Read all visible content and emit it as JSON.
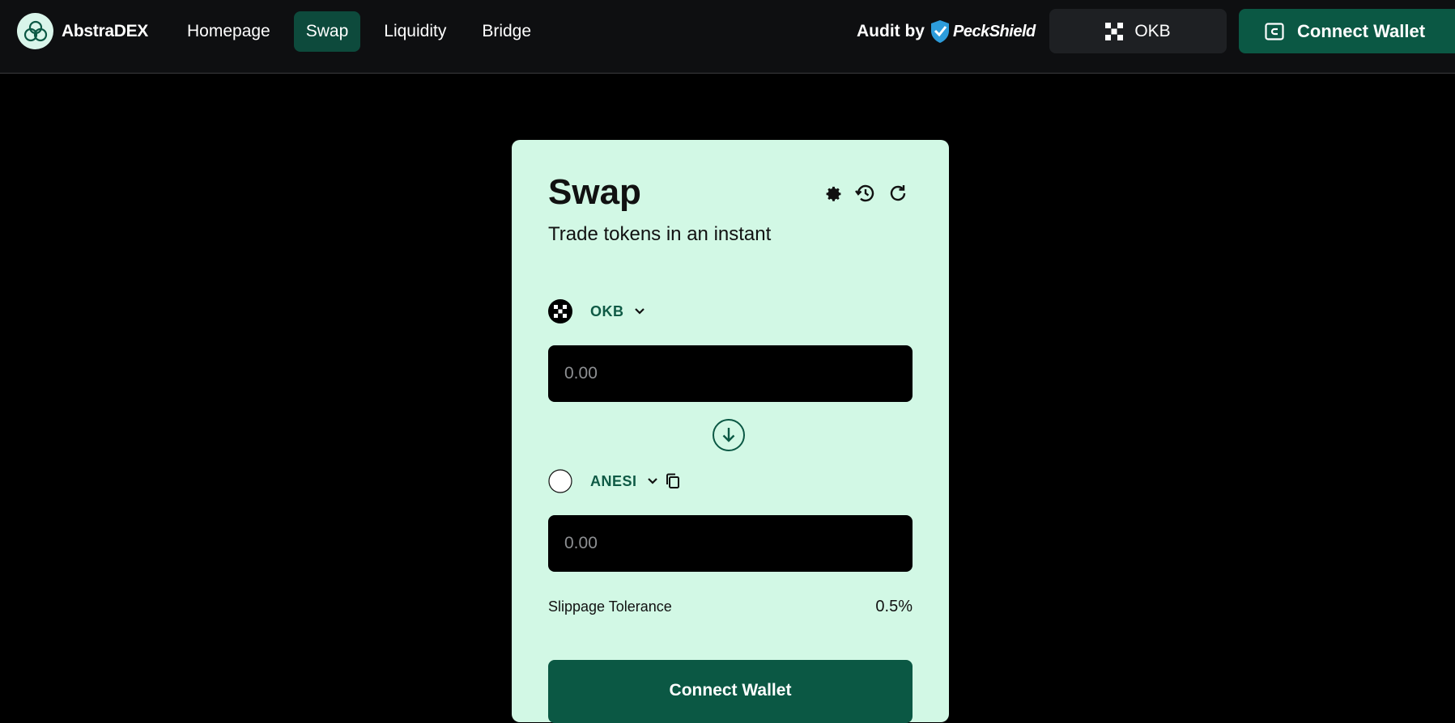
{
  "header": {
    "brand": "AbstraDEX",
    "nav": [
      {
        "label": "Homepage",
        "active": false
      },
      {
        "label": "Swap",
        "active": true
      },
      {
        "label": "Liquidity",
        "active": false
      },
      {
        "label": "Bridge",
        "active": false
      }
    ],
    "audit_label": "Audit by",
    "auditor": "PeckShield",
    "network_label": "OKB",
    "connect_label": "Connect Wallet"
  },
  "swap": {
    "title": "Swap",
    "subtitle": "Trade tokens in an instant",
    "icons": [
      "settings-icon",
      "history-icon",
      "refresh-icon"
    ],
    "from_token": "OKB",
    "from_placeholder": "0.00",
    "to_token": "ANESI",
    "to_placeholder": "0.00",
    "slippage_label": "Slippage Tolerance",
    "slippage_value": "0.5%",
    "button_label": "Connect Wallet"
  },
  "colors": {
    "accent": "#0b5844",
    "card_bg": "#d2f8e5",
    "topbar_bg": "#0e0f11"
  }
}
